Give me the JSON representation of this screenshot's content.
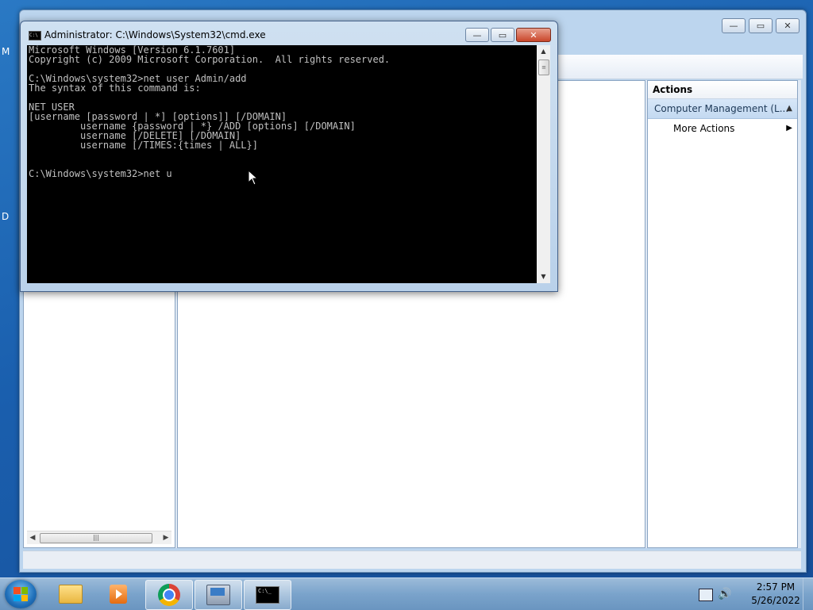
{
  "desktop": {
    "edge_label_1": "M",
    "edge_label_2": "D"
  },
  "mmc": {
    "caption_buttons": {
      "minimize": "—",
      "maximize": "▭",
      "close": "✕"
    },
    "actions": {
      "title": "Actions",
      "group_label": "Computer Management (L...",
      "items": [
        {
          "label": "More Actions"
        }
      ]
    }
  },
  "cmd": {
    "title": "Administrator: C:\\Windows\\System32\\cmd.exe",
    "buttons": {
      "minimize": "—",
      "maximize": "▭",
      "close": "✕"
    },
    "lines": [
      "Microsoft Windows [Version 6.1.7601]",
      "Copyright (c) 2009 Microsoft Corporation.  All rights reserved.",
      "",
      "C:\\Windows\\system32>net user Admin/add",
      "The syntax of this command is:",
      "",
      "NET USER",
      "[username [password | *] [options]] [/DOMAIN]",
      "         username {password | *} /ADD [options] [/DOMAIN]",
      "         username [/DELETE] [/DOMAIN]",
      "         username [/TIMES:{times | ALL}]",
      "",
      "",
      "C:\\Windows\\system32>net u"
    ]
  },
  "taskbar": {
    "apps": [
      {
        "name": "Windows Explorer",
        "icon": "folder-icon"
      },
      {
        "name": "Windows Media Player",
        "icon": "media-player-icon"
      },
      {
        "name": "Google Chrome",
        "icon": "chrome-icon"
      },
      {
        "name": "Computer Management",
        "icon": "computer-management-icon"
      },
      {
        "name": "Command Prompt",
        "icon": "cmd-icon"
      }
    ],
    "clock": {
      "time": "2:57 PM",
      "date": "5/26/2022"
    }
  },
  "colors": {
    "console_bg": "#000000",
    "console_fg": "#c0c0c0",
    "accent": "#3a78c4"
  }
}
